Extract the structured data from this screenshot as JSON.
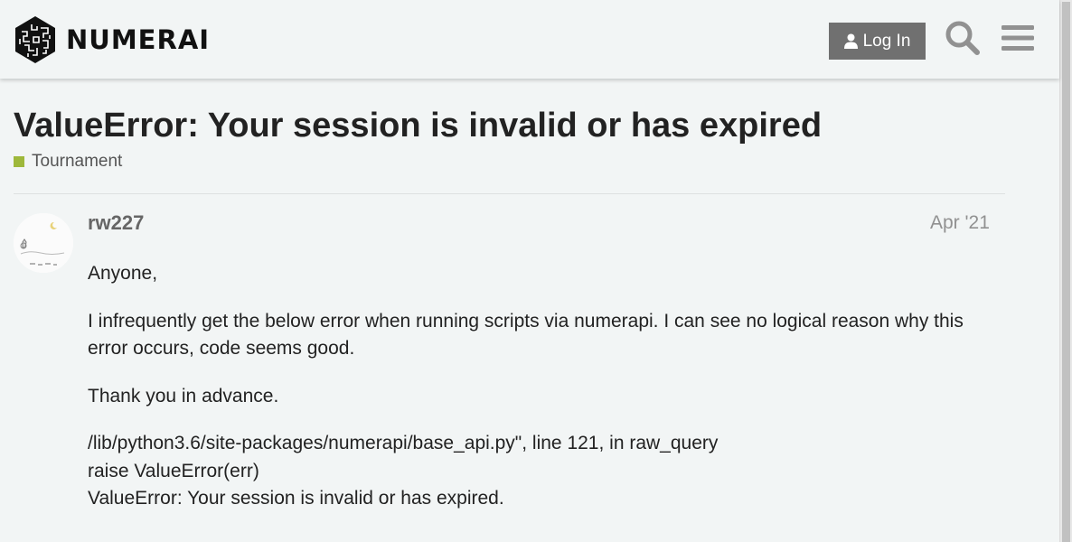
{
  "header": {
    "logo_text": "NUMERAI",
    "login_label": "Log In",
    "search_icon": "search-icon",
    "menu_icon": "hamburger-menu-icon"
  },
  "topic": {
    "title": "ValueError: Your session is invalid or has expired",
    "category": "Tournament",
    "category_color": "#9eb83b"
  },
  "post": {
    "username": "rw227",
    "date": "Apr '21",
    "paragraphs": [
      "Anyone,",
      "I infrequently get the below error when running scripts via numerapi. I can see no logical reason why this error occurs, code seems good.",
      "Thank you in advance."
    ],
    "code_lines": [
      "/lib/python3.6/site-packages/numerapi/base_api.py\", line 121, in raw_query",
      "raise ValueError(err)",
      "ValueError: Your session is invalid or has expired."
    ]
  }
}
